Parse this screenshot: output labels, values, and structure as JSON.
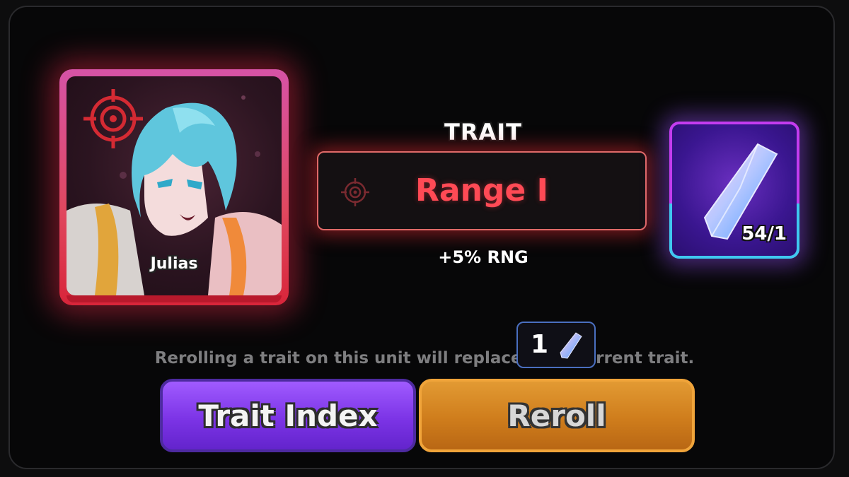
{
  "unit": {
    "name": "Julias"
  },
  "trait": {
    "heading": "TRAIT",
    "name": "Range I",
    "bonus": "+5% RNG",
    "name_color": "#ff4a55"
  },
  "currency": {
    "count": "54/1",
    "icon": "crystal-icon"
  },
  "info": {
    "text": "Rerolling a trait on this unit will replace your current trait.",
    "cost_value": "1"
  },
  "buttons": {
    "trait_index": "Trait Index",
    "reroll": "Reroll"
  },
  "colors": {
    "accent_red": "#e0485f",
    "button_purple": "#7c34e6",
    "button_orange": "#cf7d1c"
  }
}
